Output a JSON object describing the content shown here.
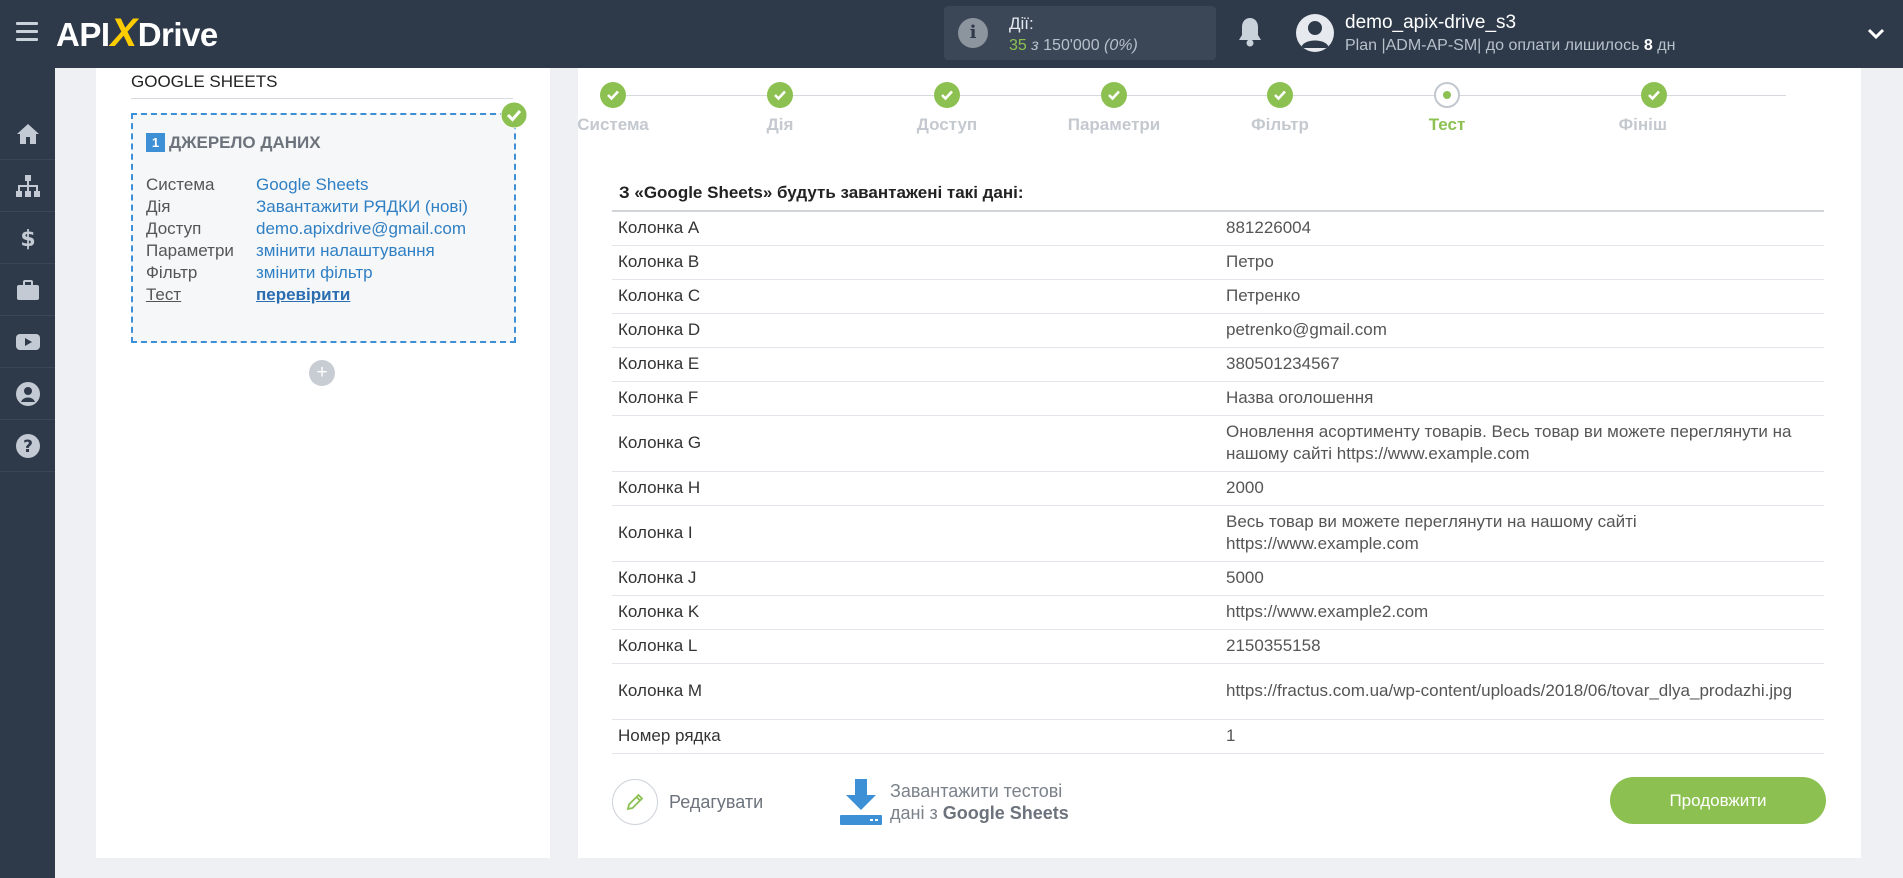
{
  "header": {
    "logo": {
      "left": "API",
      "x": "X",
      "right": "Drive"
    },
    "actions": {
      "label": "Дії:",
      "used": "35",
      "of": "з",
      "total": "150'000",
      "percent": "(0%)"
    },
    "user": {
      "name": "demo_apix-drive_s3",
      "plan_text": "Plan |ADM-AP-SM| до оплати лишилось",
      "days": "8",
      "days_unit": "дн"
    }
  },
  "sidebar": {
    "items": [
      "home-icon",
      "sitemap-icon",
      "dollar-icon",
      "briefcase-icon",
      "youtube-icon",
      "user-icon",
      "help-icon"
    ]
  },
  "left": {
    "title": "GOOGLE SHEETS",
    "source": {
      "number": "1",
      "heading": "ДЖЕРЕЛО ДАНИХ",
      "rows": [
        {
          "key": "Система",
          "value": "Google Sheets"
        },
        {
          "key": "Дія",
          "value": "Завантажити РЯДКИ (нові)"
        },
        {
          "key": "Доступ",
          "value": "demo.apixdrive@gmail.com"
        },
        {
          "key": "Параметри",
          "value": "змінити налаштування"
        },
        {
          "key": "Фільтр",
          "value": "змінити фільтр"
        },
        {
          "key": "Тест",
          "value": "перевірити"
        }
      ]
    },
    "add_label": "+"
  },
  "steps": [
    {
      "name": "Система",
      "state": "done"
    },
    {
      "name": "Дія",
      "state": "done"
    },
    {
      "name": "Доступ",
      "state": "done"
    },
    {
      "name": "Параметри",
      "state": "done"
    },
    {
      "name": "Фільтр",
      "state": "done"
    },
    {
      "name": "Тест",
      "state": "current"
    },
    {
      "name": "Фініш",
      "state": "done"
    }
  ],
  "main": {
    "title": "З «Google Sheets» будуть завантажені такі дані:",
    "rows": [
      {
        "key": "Колонка A",
        "value": "881226004"
      },
      {
        "key": "Колонка B",
        "value": "Петро"
      },
      {
        "key": "Колонка C",
        "value": "Петренко"
      },
      {
        "key": "Колонка D",
        "value": "petrenko@gmail.com"
      },
      {
        "key": "Колонка E",
        "value": "380501234567"
      },
      {
        "key": "Колонка F",
        "value": "Назва оголошення"
      },
      {
        "key": "Колонка G",
        "value": "Оновлення асортименту товарів. Весь товар ви можете переглянути на нашому сайті https://www.example.com"
      },
      {
        "key": "Колонка H",
        "value": "2000"
      },
      {
        "key": "Колонка I",
        "value": "Весь товар ви можете переглянути на нашому сайті https://www.example.com"
      },
      {
        "key": "Колонка J",
        "value": "5000"
      },
      {
        "key": "Колонка K",
        "value": "https://www.example2.com"
      },
      {
        "key": "Колонка L",
        "value": "2150355158"
      },
      {
        "key": "Колонка M",
        "value": "https://fractus.com.ua/wp-content/uploads/2018/06/tovar_dlya_prodazhi.jpg"
      },
      {
        "key": "Номер рядка",
        "value": "1"
      }
    ],
    "edit_label": "Редагувати",
    "load_label_1": "Завантажити тестові",
    "load_label_2": "дані з",
    "load_label_3": "Google Sheets",
    "continue_label": "Продовжити"
  },
  "colors": {
    "accent_green": "#8cc152",
    "accent_blue": "#3d8fd6",
    "topbar": "#2e3a4a"
  }
}
